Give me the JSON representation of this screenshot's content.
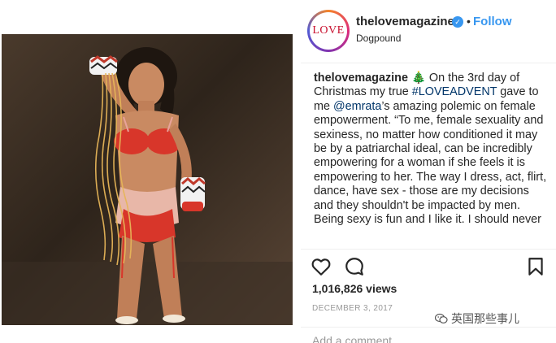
{
  "post": {
    "avatar_text": "LOVE",
    "username": "thelovemagazine",
    "verified_glyph": "✓",
    "separator": "•",
    "follow_label": "Follow",
    "location": "Dogpound",
    "photo_alt": "Post photo",
    "caption": {
      "user": "thelovemagazine",
      "emoji": "🎄",
      "text_1": "On the 3rd day of Christmas my true ",
      "hashtag": "#LOVEADVENT",
      "text_2": " gave to me ",
      "mention": "@emrata",
      "text_3": "’s amazing polemic on female empowerment. “To me, female sexuality and sexiness, no matter how conditioned it may be by a patriarchal ideal, can be incredibly empowering for a woman if she feels it is empowering to her. The way I dress, act, flirt, dance, have sex - those are my decisions and they shouldn't be impacted by men. Being sexy is fun and I like it. I should never"
    },
    "actions": {
      "like_icon": "heart-icon",
      "comment_icon": "comment-icon",
      "save_icon": "bookmark-icon"
    },
    "views": "1,016,826 views",
    "date": "DECEMBER 3, 2017",
    "comment_placeholder": "Add a comment…"
  },
  "watermark": {
    "text": "英国那些事儿"
  },
  "colors": {
    "link": "#003569",
    "follow": "#3897f0",
    "avatar_text": "#c8102e"
  }
}
